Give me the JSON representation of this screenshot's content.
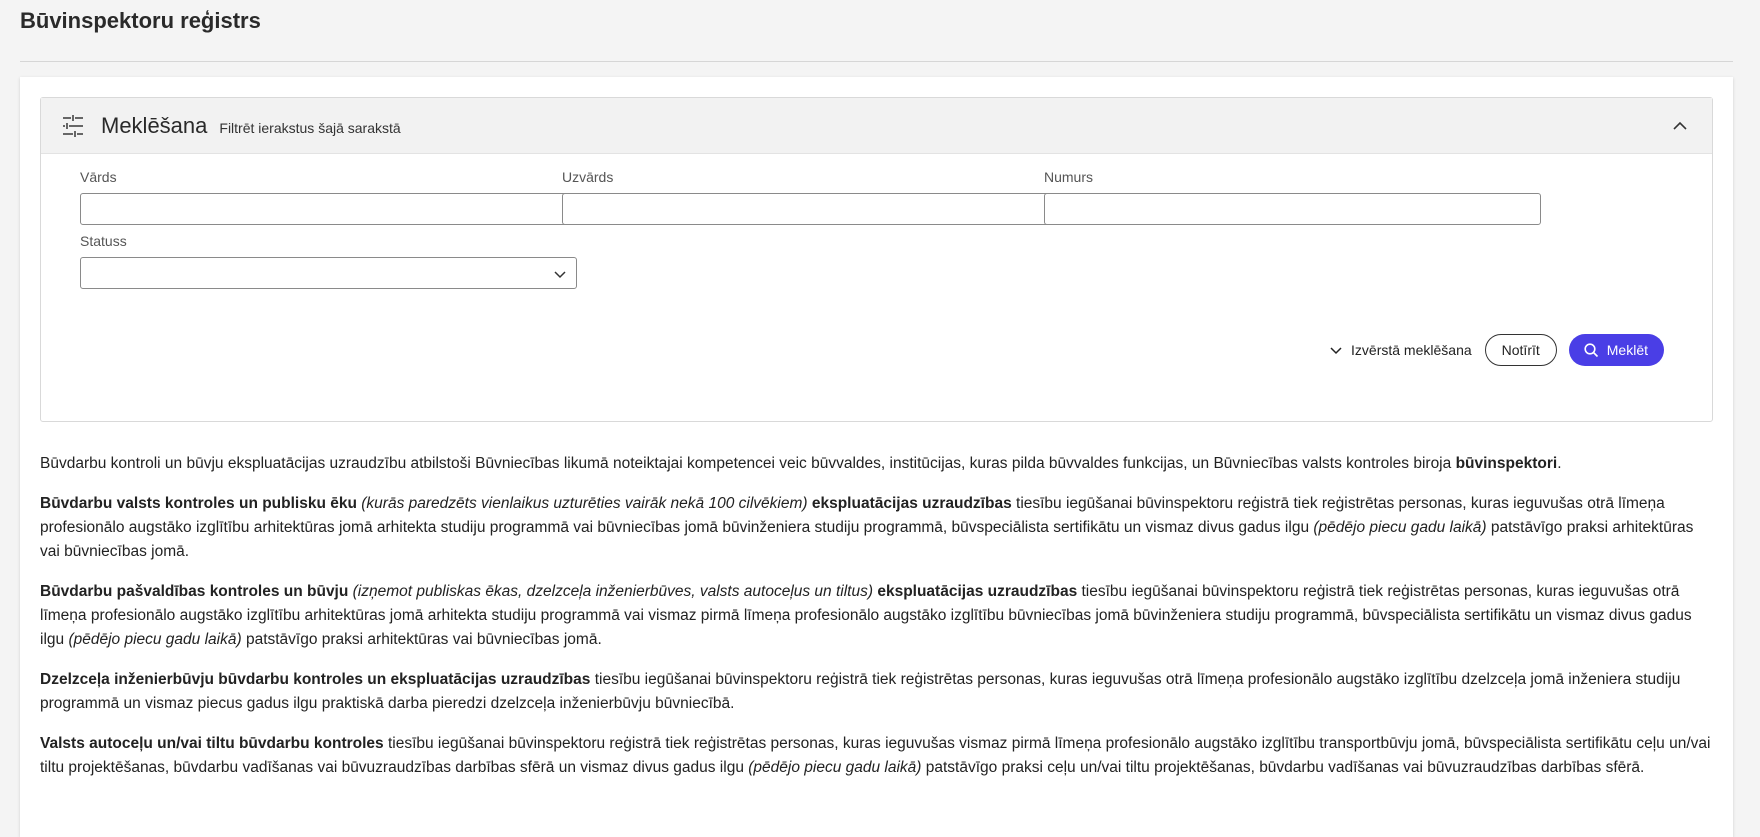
{
  "page": {
    "title": "Būvinspektoru reģistrs"
  },
  "search": {
    "title": "Meklēšana",
    "subtitle": "Filtrēt ierakstus šajā sarakstā",
    "fields": {
      "vards_label": "Vārds",
      "uzvards_label": "Uzvārds",
      "numurs_label": "Numurs",
      "statuss_label": "Statuss",
      "vards_value": "",
      "uzvards_value": "",
      "numurs_value": ""
    },
    "advanced_label": "Izvērstā meklēšana",
    "clear_label": "Notīrīt",
    "search_label": "Meklēt"
  },
  "icons": {
    "filter": "sliders-icon",
    "collapse": "chevron-up-icon",
    "select": "chevron-down-icon",
    "advanced": "chevron-down-icon",
    "search": "search-icon"
  },
  "colors": {
    "primary": "#4a3ee6",
    "header_bg": "#f2f2f2"
  },
  "content": {
    "p1": {
      "a": "Būvdarbu kontroli un būvju ekspluatācijas uzraudzību atbilstoši Būvniecības likumā noteiktajai kompetencei veic būvvaldes, institūcijas, kuras pilda būvvaldes funkcijas, un Būvniecības valsts kontroles biroja ",
      "b": "būvinspektori",
      "c": "."
    },
    "p2": {
      "a": "Būvdarbu valsts kontroles un publisku ēku",
      "b": " (kurās paredzēts vienlaikus uzturēties vairāk nekā 100 cilvēkiem) ",
      "c": "ekspluatācijas uzraudzības",
      "d": " tiesību iegūšanai būvinspektoru reģistrā tiek reģistrētas personas, kuras ieguvušas otrā līmeņa profesionālo augstāko izglītību arhitektūras jomā arhitekta studiju programmā vai būvniecības jomā būvinženiera studiju programmā, būvspeciālista sertifikātu un vismaz divus gadus ilgu ",
      "e": "(pēdējo piecu gadu laikā)",
      "f": " patstāvīgo praksi arhitektūras vai būvniecības jomā."
    },
    "p3": {
      "a": "Būvdarbu pašvaldības kontroles un būvju",
      "b": " (izņemot publiskas ēkas, dzelzceļa inženierbūves, valsts autoceļus un tiltus) ",
      "c": "ekspluatācijas uzraudzības",
      "d": " tiesību iegūšanai būvinspektoru reģistrā tiek reģistrētas personas, kuras ieguvušas otrā līmeņa profesionālo augstāko izglītību arhitektūras jomā arhitekta studiju programmā vai vismaz pirmā līmeņa profesionālo augstāko izglītību būvniecības jomā būvinženiera studiju programmā, būvspeciālista sertifikātu un vismaz divus gadus ilgu ",
      "e": "(pēdējo piecu gadu laikā)",
      "f": " patstāvīgo praksi arhitektūras vai būvniecības jomā."
    },
    "p4": {
      "a": "Dzelzceļa inženierbūvju būvdarbu kontroles un ekspluatācijas uzraudzības",
      "b": " tiesību iegūšanai būvinspektoru reģistrā tiek reģistrētas personas, kuras ieguvušas otrā līmeņa profesionālo augstāko izglītību dzelzceļa jomā inženiera studiju programmā un vismaz piecus gadus ilgu praktiskā darba pieredzi dzelzceļa inženierbūvju būvniecībā."
    },
    "p5": {
      "a": "Valsts autoceļu un/vai tiltu būvdarbu kontroles",
      "b": " tiesību iegūšanai būvinspektoru reģistrā tiek reģistrētas personas, kuras ieguvušas vismaz pirmā līmeņa profesionālo augstāko izglītību transportbūvju jomā, būvspeciālista sertifikātu ceļu un/vai tiltu projektēšanas, būvdarbu vadīšanas vai būvuzraudzības darbības sfērā un vismaz divus gadus ilgu ",
      "c": "(pēdējo piecu gadu laikā)",
      "d": " patstāvīgo praksi ceļu un/vai tiltu projektēšanas, būvdarbu vadīšanas vai būvuzraudzības darbības sfērā."
    }
  }
}
